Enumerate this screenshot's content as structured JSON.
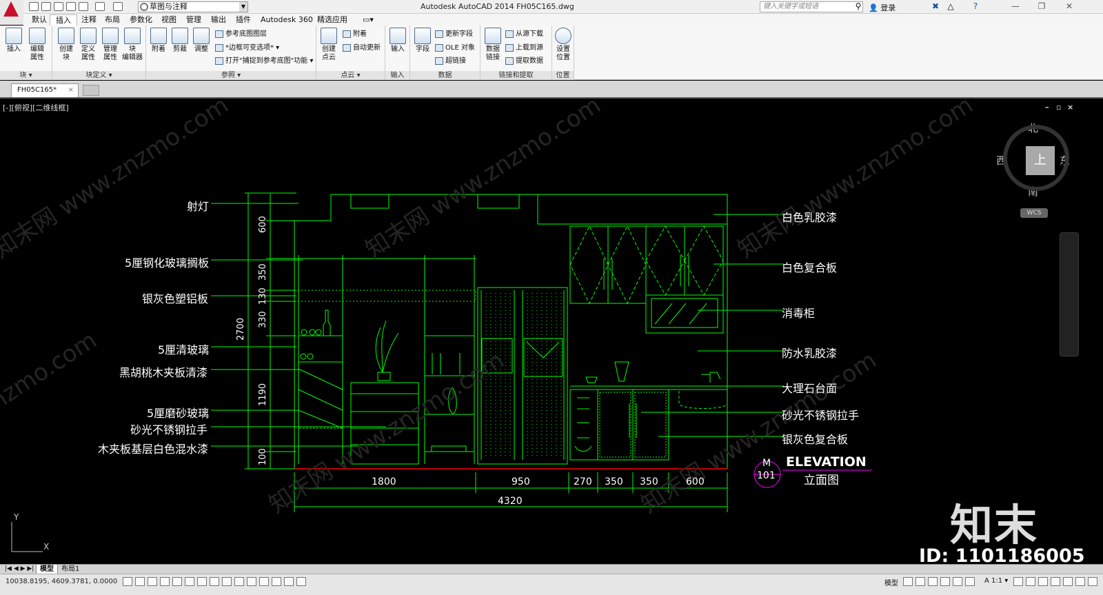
{
  "app": {
    "window_title": "Autodesk AutoCAD 2014    FH05C165.dwg",
    "workspace": "草图与注释",
    "search_placeholder": "键入关键字或短语",
    "login": "登录"
  },
  "ribbon_tabs": [
    "默认",
    "插入",
    "注释",
    "布局",
    "参数化",
    "视图",
    "管理",
    "输出",
    "插件",
    "Autodesk 360",
    "精选应用"
  ],
  "active_tab": "插入",
  "panels": {
    "block": {
      "label": "块",
      "insert": "插入",
      "edit_attr": "编辑\n属性"
    },
    "block_def": {
      "label": "块定义",
      "create": "创建\n块",
      "define_attr": "定义\n属性",
      "manage_attr": "管理\n属性",
      "block_editor": "块\n编辑器"
    },
    "reference": {
      "label": "参照",
      "attach": "附着",
      "clip": "剪裁",
      "adjust": "调整",
      "underlay_layers": "参考底图图层",
      "frame_variable": "*边框可变选项*",
      "snap_underlay": "打开\"捕捉到参考底图\"功能"
    },
    "pointcloud": {
      "label": "点云",
      "create": "创建\n点云",
      "attach": "附着",
      "auto_update": "自动更新"
    },
    "import": {
      "label": "输入",
      "import": "输入"
    },
    "data": {
      "label": "数据",
      "field": "字段",
      "update_fields": "更新字段",
      "ole": "OLE 对象",
      "hyperlink": "超链接"
    },
    "linking": {
      "label": "链接和提取",
      "data_link": "数据\n链接",
      "download_source": "从源下载",
      "upload_source": "上载到源",
      "extract_data": "提取数据"
    },
    "location": {
      "label": "位置",
      "set_location": "设置\n位置"
    }
  },
  "document_tab": "FH05C165*",
  "viewport_label": "[-][俯视][二维线框]",
  "viewcube": {
    "top": "上",
    "north": "北",
    "south": "南",
    "east": "东",
    "west": "西",
    "wcs": "WCS"
  },
  "drawing": {
    "left_labels": [
      "射灯",
      "5厘钢化玻璃搁板",
      "银灰色塑铝板",
      "5厘清玻璃",
      "黑胡桃木夹板清漆",
      "5厘磨砂玻璃",
      "砂光不锈钢拉手",
      "木夹板基层白色混水漆"
    ],
    "right_labels": [
      "白色乳胶漆",
      "白色复合板",
      "消毒柜",
      "防水乳胶漆",
      "大理石台面",
      "砂光不锈钢拉手",
      "银灰色复合板"
    ],
    "vertical_dims": [
      "600",
      "350",
      "130",
      "330",
      "1190",
      "100"
    ],
    "total_height": "2700",
    "horizontal_dims": [
      "1800",
      "950",
      "270",
      "350",
      "350",
      "600"
    ],
    "total_width": "4320",
    "elevation_title": "ELEVATION",
    "elevation_subtitle": "立面图",
    "elevation_m": "M",
    "elevation_number": "101"
  },
  "watermark": {
    "logo": "知末",
    "id": "ID: 1101186005"
  },
  "ucs": {
    "y": "Y",
    "x": "X"
  },
  "layout_tabs": [
    "模型",
    "布局1"
  ],
  "status": {
    "coords": "10038.8195, 4609.3781, 0.0000",
    "model": "模型",
    "scale": "1:1"
  },
  "colors": {
    "line": "#00ff00",
    "white_line": "#ffffff",
    "cyan": "#00ffff",
    "magenta": "#ff00ff",
    "red": "#ff0000",
    "canvas_bg": "#000000"
  }
}
